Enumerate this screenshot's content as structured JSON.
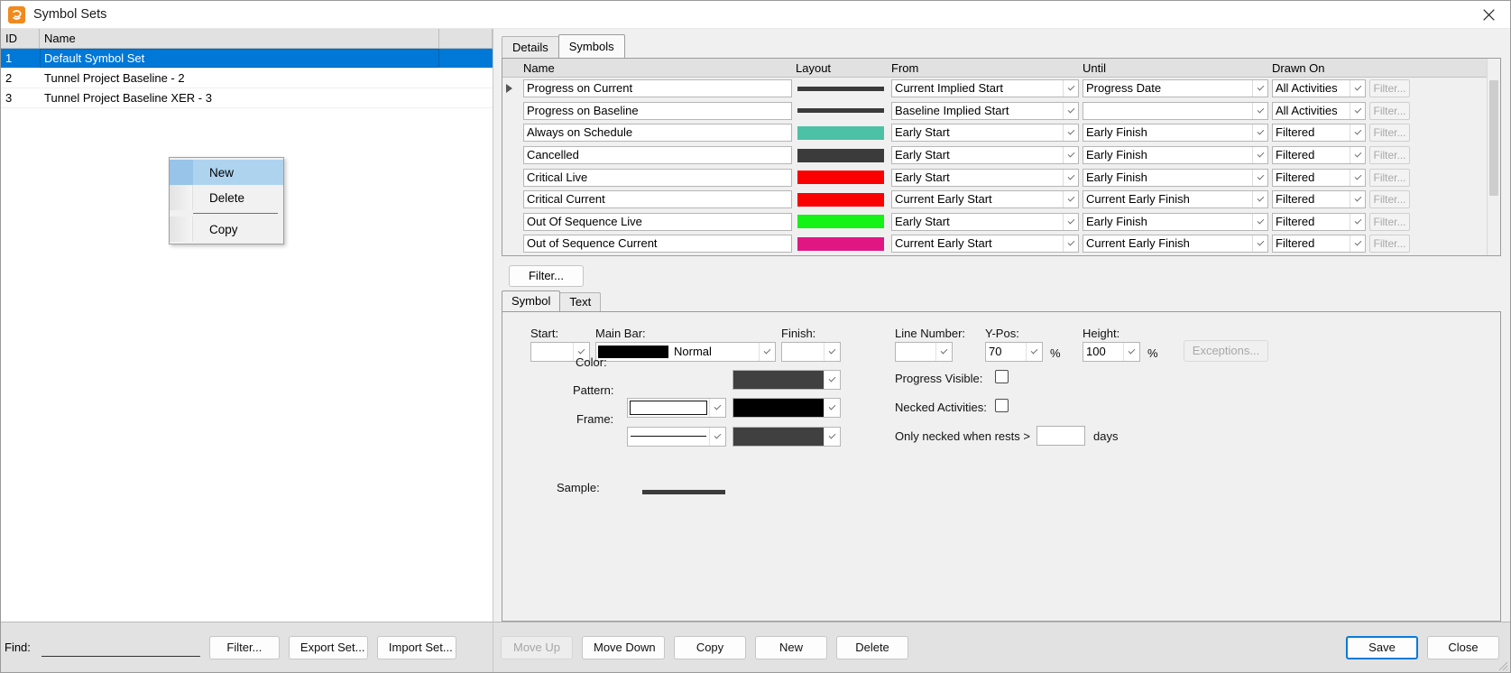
{
  "window": {
    "title": "Symbol Sets",
    "app_icon": "spiral-icon",
    "close_icon": "close-icon"
  },
  "left": {
    "columns": [
      "ID",
      "Name"
    ],
    "rows": [
      {
        "id": "1",
        "name": "Default Symbol Set",
        "selected": true
      },
      {
        "id": "2",
        "name": "Tunnel Project Baseline - 2",
        "selected": false
      },
      {
        "id": "3",
        "name": "Tunnel Project Baseline XER - 3",
        "selected": false
      }
    ],
    "context_menu": {
      "items": [
        {
          "label": "New",
          "highlighted": true
        },
        {
          "label": "Delete",
          "highlighted": false
        },
        {
          "label": "Copy",
          "highlighted": false
        }
      ]
    },
    "find_label": "Find:",
    "find_value": "",
    "find_placeholder": "",
    "buttons": [
      "Filter...",
      "Export Set...",
      "Import Set..."
    ]
  },
  "right": {
    "tabs": [
      {
        "label": "Details",
        "active": false
      },
      {
        "label": "Symbols",
        "active": true
      }
    ],
    "grid": {
      "columns": [
        "Name",
        "Layout",
        "From",
        "Until",
        "Drawn On",
        ""
      ],
      "rows": [
        {
          "name": "Progress on Current",
          "layout_color": "#3b3b3b",
          "layout_style": "thin",
          "from": "Current Implied Start",
          "until": "Progress Date",
          "drawn_on": "All Activities",
          "filter": "Filter...",
          "current": true
        },
        {
          "name": "Progress on Baseline",
          "layout_color": "#3b3b3b",
          "layout_style": "thin",
          "from": "Baseline Implied Start",
          "until": "",
          "drawn_on": "All Activities",
          "filter": "Filter...",
          "current": false
        },
        {
          "name": "Always on Schedule",
          "layout_color": "#4cc1a5",
          "layout_style": "thick",
          "from": "Early Start",
          "until": "Early Finish",
          "drawn_on": "Filtered",
          "filter": "Filter...",
          "current": false
        },
        {
          "name": "Cancelled",
          "layout_color": "#3b3b3b",
          "layout_style": "thick",
          "from": "Early Start",
          "until": "Early Finish",
          "drawn_on": "Filtered",
          "filter": "Filter...",
          "current": false
        },
        {
          "name": "Critical Live",
          "layout_color": "#fb0000",
          "layout_style": "thick",
          "from": "Early Start",
          "until": "Early Finish",
          "drawn_on": "Filtered",
          "filter": "Filter...",
          "current": false
        },
        {
          "name": "Critical Current",
          "layout_color": "#fb0000",
          "layout_style": "thick",
          "from": "Current Early Start",
          "until": "Current Early Finish",
          "drawn_on": "Filtered",
          "filter": "Filter...",
          "current": false
        },
        {
          "name": "Out Of Sequence Live",
          "layout_color": "#15f215",
          "layout_style": "thick",
          "from": "Early Start",
          "until": "Early Finish",
          "drawn_on": "Filtered",
          "filter": "Filter...",
          "current": false
        },
        {
          "name": "Out of Sequence Current",
          "layout_color": "#e01783",
          "layout_style": "thick",
          "from": "Current Early Start",
          "until": "Current Early Finish",
          "drawn_on": "Filtered",
          "filter": "Filter...",
          "current": false
        }
      ]
    },
    "filter_button": "Filter...",
    "sub_tabs": [
      {
        "label": "Symbol",
        "active": true
      },
      {
        "label": "Text",
        "active": false
      }
    ],
    "symbol_form": {
      "start_label": "Start:",
      "start_value": "",
      "main_bar_label": "Main Bar:",
      "main_bar_value": "Normal",
      "main_bar_swatch": "#000000",
      "finish_label": "Finish:",
      "finish_value": "",
      "color_label": "Color:",
      "color_swatch": "#404040",
      "pattern_label": "Pattern:",
      "pattern_swatch": "#000000",
      "frame_label": "Frame:",
      "frame_swatch": "#404040",
      "line_number_label": "Line Number:",
      "line_number_value": "",
      "ypos_label": "Y-Pos:",
      "ypos_value": "70",
      "ypos_unit": "%",
      "height_label": "Height:",
      "height_value": "100",
      "height_unit": "%",
      "exceptions_button": "Exceptions...",
      "progress_visible_label": "Progress Visible:",
      "progress_visible_checked": false,
      "necked_activities_label": "Necked Activities:",
      "necked_activities_checked": false,
      "only_necked_label": "Only necked when rests >",
      "only_necked_value": "",
      "only_necked_unit": "days",
      "sample_label": "Sample:",
      "sample_color": "#3b3b3b"
    },
    "bottom_buttons": [
      {
        "label": "Move Up",
        "disabled": true,
        "primary": false
      },
      {
        "label": "Move Down",
        "disabled": false,
        "primary": false
      },
      {
        "label": "Copy",
        "disabled": false,
        "primary": false
      },
      {
        "label": "New",
        "disabled": false,
        "primary": false
      },
      {
        "label": "Delete",
        "disabled": false,
        "primary": false
      }
    ],
    "action_buttons": [
      {
        "label": "Save",
        "primary": true
      },
      {
        "label": "Close",
        "primary": false
      }
    ]
  }
}
